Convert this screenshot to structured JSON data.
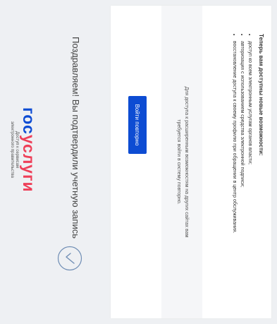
{
  "logo": {
    "part1": "гос",
    "part2": "услуги",
    "subtitle_line1": "Доступ к сервисам",
    "subtitle_line2": "электронного правительства",
    "colors": {
      "primary": "#0d4cd3",
      "accent": "#ee3f58"
    }
  },
  "header": {
    "congrats": "Поздравляем! Вы подтвердили учетную запись"
  },
  "features": {
    "title": "Теперь вам доступны новые возможности:",
    "items": [
      "доступ ко всем электронным услугам органов власти;",
      "авторизация с использованием средства электронной подписи;",
      "восстановление доступа к своему профилю при обращении в центр обслуживания."
    ]
  },
  "notice": {
    "line1": "Для доступа к расширенным возможностям на других сайтах вам",
    "line2": "требуется войти в систему повторно."
  },
  "button": {
    "label": "Войти повторно",
    "color": "#0d4cd3"
  },
  "icons": {
    "success": "check-circle-icon"
  }
}
